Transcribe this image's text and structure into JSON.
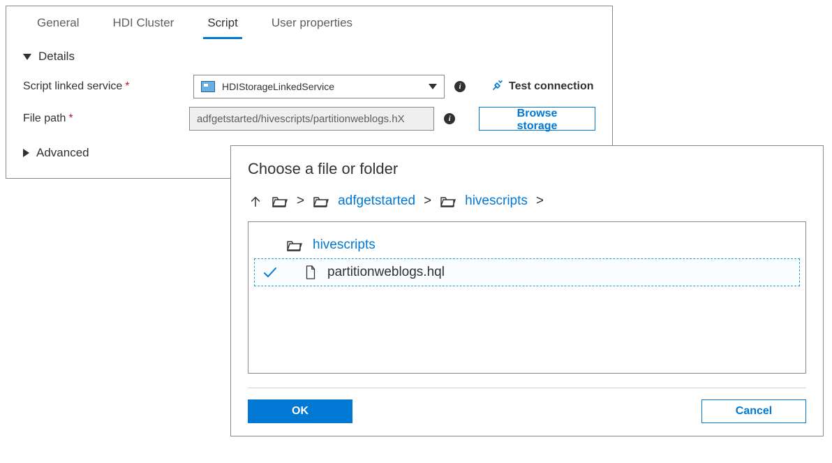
{
  "tabs": {
    "general": "General",
    "hdi": "HDI Cluster",
    "script": "Script",
    "userprops": "User properties"
  },
  "sections": {
    "details": "Details",
    "advanced": "Advanced"
  },
  "form": {
    "linked_service_label": "Script linked service",
    "linked_service_value": "HDIStorageLinkedService",
    "file_path_label": "File path",
    "file_path_value": "adfgetstarted/hivescripts/partitionweblogs.hX",
    "test_connection": "Test connection",
    "browse_storage": "Browse storage"
  },
  "dialog": {
    "title": "Choose a file or folder",
    "breadcrumb": {
      "seg1": "adfgetstarted",
      "seg2": "hivescripts"
    },
    "rows": {
      "folder": "hivescripts",
      "file": "partitionweblogs.hql"
    },
    "ok": "OK",
    "cancel": "Cancel"
  }
}
